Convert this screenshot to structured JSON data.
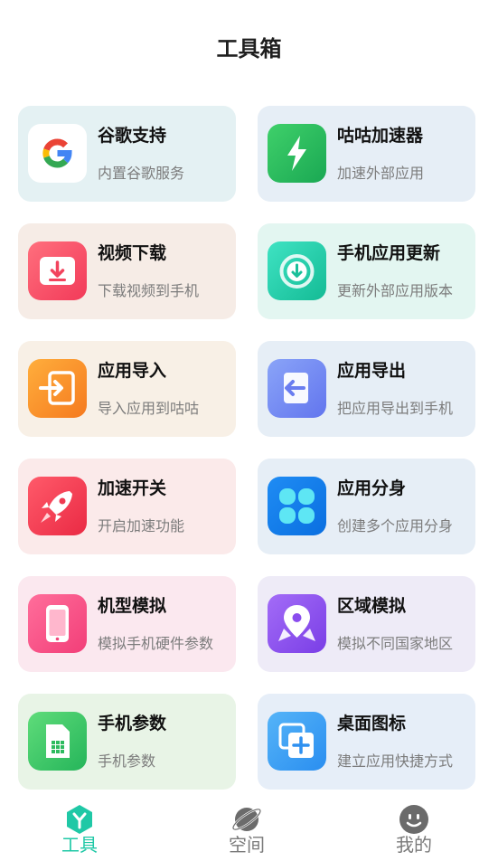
{
  "header": {
    "title": "工具箱"
  },
  "tools": [
    {
      "id": "google",
      "title": "谷歌支持",
      "subtitle": "内置谷歌服务",
      "bg": "#e4f1f3",
      "icon": "google-icon"
    },
    {
      "id": "accel",
      "title": "咕咕加速器",
      "subtitle": "加速外部应用",
      "bg": "#e6eef6",
      "icon": "lightning-icon"
    },
    {
      "id": "video",
      "title": "视频下载",
      "subtitle": "下载视频到手机",
      "bg": "#f6ece6",
      "icon": "download-icon"
    },
    {
      "id": "update",
      "title": "手机应用更新",
      "subtitle": "更新外部应用版本",
      "bg": "#e3f6f1",
      "icon": "update-icon"
    },
    {
      "id": "import",
      "title": "应用导入",
      "subtitle": "导入应用到咕咕",
      "bg": "#f8f0e6",
      "icon": "import-icon"
    },
    {
      "id": "export",
      "title": "应用导出",
      "subtitle": "把应用导出到手机",
      "bg": "#e6eef6",
      "icon": "export-icon"
    },
    {
      "id": "speed",
      "title": "加速开关",
      "subtitle": "开启加速功能",
      "bg": "#fbeaea",
      "icon": "rocket-icon"
    },
    {
      "id": "clone",
      "title": "应用分身",
      "subtitle": "创建多个应用分身",
      "bg": "#e6eef6",
      "icon": "clover-icon"
    },
    {
      "id": "model",
      "title": "机型模拟",
      "subtitle": "模拟手机硬件参数",
      "bg": "#fbe8ef",
      "icon": "phone-icon"
    },
    {
      "id": "region",
      "title": "区域模拟",
      "subtitle": "模拟不同国家地区",
      "bg": "#eeebf7",
      "icon": "location-icon"
    },
    {
      "id": "params",
      "title": "手机参数",
      "subtitle": "手机参数",
      "bg": "#e8f4e6",
      "icon": "sim-card-icon"
    },
    {
      "id": "shortcut",
      "title": "桌面图标",
      "subtitle": "建立应用快捷方式",
      "bg": "#e6eef8",
      "icon": "shortcut-icon"
    }
  ],
  "tabs": [
    {
      "label": "工具",
      "icon": "tools-icon",
      "active": true
    },
    {
      "label": "空间",
      "icon": "planet-icon",
      "active": false
    },
    {
      "label": "我的",
      "icon": "face-icon",
      "active": false
    }
  ],
  "colors": {
    "accent": "#1fc8a6",
    "inactive": "#7a7a7a"
  }
}
